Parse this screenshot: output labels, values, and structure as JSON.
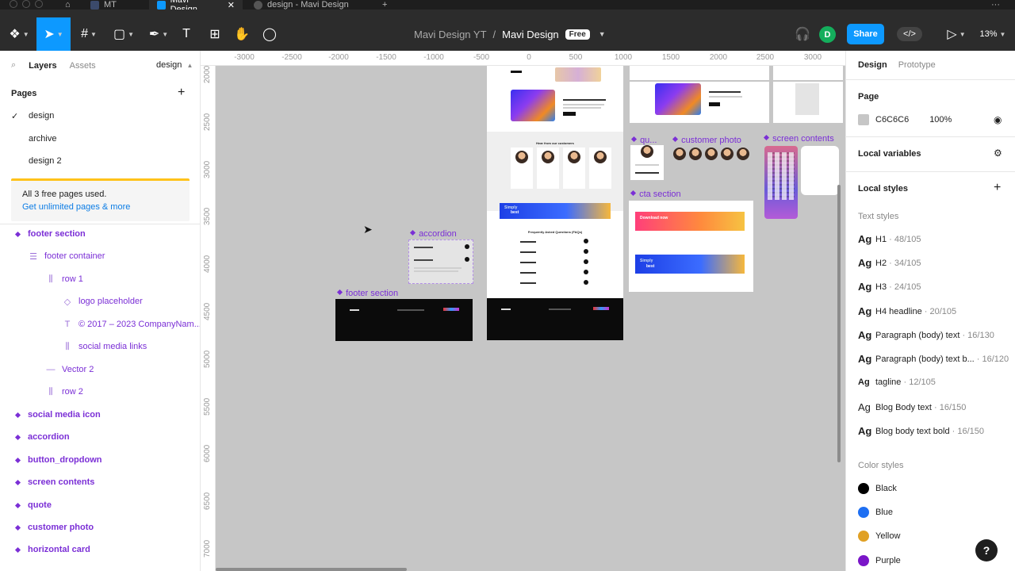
{
  "browser_tabs": [
    {
      "label": "MT"
    },
    {
      "label": "Mavi Design",
      "active": true
    },
    {
      "label": "design - Mavi Design"
    }
  ],
  "toolbar": {
    "team_name": "Mavi Design YT",
    "file_name": "Mavi Design",
    "plan_badge": "Free",
    "share_label": "Share",
    "avatar_initial": "D",
    "zoom": "13%",
    "code_label": "</>"
  },
  "left_panel": {
    "tabs": {
      "layers": "Layers",
      "assets": "Assets",
      "page_switch": "design"
    },
    "pages_title": "Pages",
    "pages": [
      "design",
      "archive",
      "design 2"
    ],
    "notice": {
      "text": "All 3 free pages used.",
      "link": "Get unlimited pages & more"
    },
    "layers": [
      {
        "label": "footer section",
        "kind": "component"
      },
      {
        "label": "footer container",
        "kind": "frame"
      },
      {
        "label": "row 1",
        "kind": "autolayout"
      },
      {
        "label": "logo placeholder",
        "kind": "instance"
      },
      {
        "label": "© 2017 – 2023 CompanyNam...",
        "kind": "text"
      },
      {
        "label": "social media links",
        "kind": "autolayout"
      },
      {
        "label": "Vector 2",
        "kind": "vector"
      },
      {
        "label": "row 2",
        "kind": "autolayout"
      },
      {
        "label": "social media icon",
        "kind": "component"
      },
      {
        "label": "accordion",
        "kind": "component"
      },
      {
        "label": "button_dropdown",
        "kind": "component"
      },
      {
        "label": "screen contents",
        "kind": "component"
      },
      {
        "label": "quote",
        "kind": "component"
      },
      {
        "label": "customer photo",
        "kind": "component"
      },
      {
        "label": "horizontal card",
        "kind": "component"
      }
    ]
  },
  "rulers": {
    "top": [
      "-3000",
      "-2500",
      "-2000",
      "-1500",
      "-1000",
      "-500",
      "0",
      "500",
      "1000",
      "1500",
      "2000",
      "2500",
      "3000"
    ],
    "left": [
      "2000",
      "2500",
      "3000",
      "3500",
      "4000",
      "4500",
      "5000",
      "5500",
      "6000",
      "6500",
      "7000"
    ]
  },
  "canvas": {
    "labels": {
      "accordion": "accordion",
      "footer_section": "footer section",
      "quote": "qu...",
      "customer_photo": "customer photo",
      "screen_contents": "screen contents",
      "cta_section": "cta section"
    },
    "mini_text": {
      "testimonials": "Hear from our customers",
      "faq": "Frequently Asked Questions (FAQs)",
      "simply": "Simply",
      "best": "best",
      "download": "Download now"
    }
  },
  "right_panel": {
    "tabs": {
      "design": "Design",
      "prototype": "Prototype"
    },
    "page_section": "Page",
    "page_color": "C6C6C6",
    "page_opacity": "100%",
    "local_variables": "Local variables",
    "local_styles": "Local styles",
    "text_styles_title": "Text styles",
    "text_styles": [
      {
        "name": "H1",
        "meta": " · 48/105"
      },
      {
        "name": "H2",
        "meta": " · 34/105"
      },
      {
        "name": "H3",
        "meta": " · 24/105"
      },
      {
        "name": "H4 headline",
        "meta": " · 20/105"
      },
      {
        "name": "Paragraph (body) text",
        "meta": " · 16/130"
      },
      {
        "name": "Paragraph (body) text b...",
        "meta": " · 16/120"
      },
      {
        "name": "tagline",
        "meta": " · 12/105"
      },
      {
        "name": "Blog Body text",
        "meta": " · 16/150"
      },
      {
        "name": "Blog body text bold",
        "meta": " · 16/150"
      }
    ],
    "color_styles_title": "Color styles",
    "color_styles": [
      {
        "name": "Black",
        "color": "#000000"
      },
      {
        "name": "Blue",
        "color": "#1e6ff2"
      },
      {
        "name": "Yellow",
        "color": "#e0a024"
      },
      {
        "name": "Purple",
        "color": "#7a16c8"
      }
    ]
  },
  "help": "?"
}
